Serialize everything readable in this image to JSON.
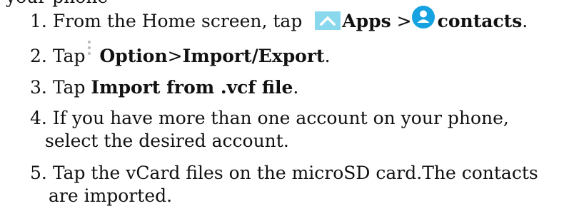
{
  "cutoff_text": "your phone",
  "steps": [
    {
      "num": "1.",
      "text1": "From the Home screen, tap",
      "apps_label": "Apps",
      "sep": ">",
      "contacts_label": "contacts",
      "end": "."
    },
    {
      "num": "2.",
      "text1": "Tap",
      "option_label": "Option",
      "sep": ">",
      "import_export_label": "Import/Export",
      "end": "."
    },
    {
      "num": "3.",
      "text1": "Tap",
      "import_vcf_label": "Import from .vcf file",
      "end": "."
    },
    {
      "num": "4.",
      "line1": "If you have more than one account on your phone,",
      "line2": "select the desired account."
    },
    {
      "num": "5.",
      "line1": "Tap the vCard files on the microSD card.The contacts",
      "line2": "are imported."
    }
  ],
  "icons": {
    "apps": "apps-chevron-up-icon",
    "contacts": "contacts-person-icon",
    "option": "vertical-dots-icon"
  },
  "colors": {
    "apps_icon_bg": "#8ad8ee",
    "contacts_icon_bg": "#14a3e0",
    "option_dots": "#b8b8b8"
  }
}
